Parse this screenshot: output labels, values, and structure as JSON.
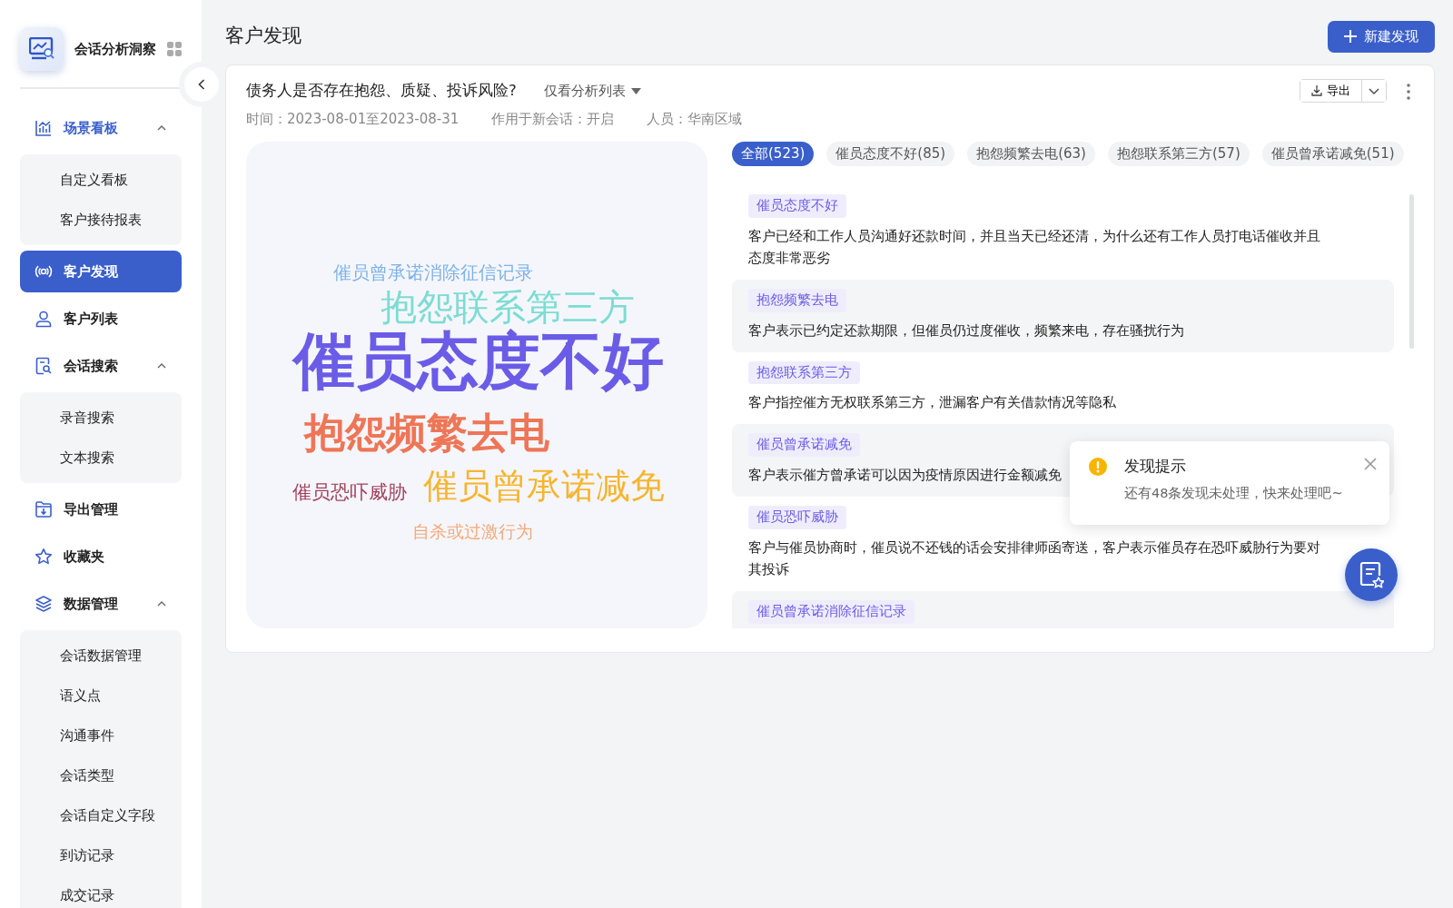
{
  "sidebar": {
    "app_title": "会话分析洞察",
    "items": [
      {
        "label": "场景看板",
        "selected": false,
        "active": true,
        "expanded": true,
        "children": [
          {
            "label": "自定义看板",
            "selected": false
          },
          {
            "label": "客户接待报表",
            "selected": false
          }
        ]
      },
      {
        "label": "客户发现",
        "selected": true,
        "active": false
      },
      {
        "label": "客户列表",
        "selected": false,
        "active": false
      },
      {
        "label": "会话搜索",
        "selected": false,
        "active": false,
        "expanded": true,
        "children": [
          {
            "label": "录音搜索",
            "selected": false
          },
          {
            "label": "文本搜索",
            "selected": false
          }
        ]
      },
      {
        "label": "导出管理",
        "selected": false,
        "active": false
      },
      {
        "label": "收藏夹",
        "selected": false,
        "active": false
      },
      {
        "label": "数据管理",
        "selected": false,
        "active": false,
        "expanded": true,
        "children": [
          {
            "label": "会话数据管理",
            "selected": false
          },
          {
            "label": "语义点",
            "selected": false
          },
          {
            "label": "沟通事件",
            "selected": false
          },
          {
            "label": "会话类型",
            "selected": false
          },
          {
            "label": "会话自定义字段",
            "selected": false
          },
          {
            "label": "到访记录",
            "selected": false
          },
          {
            "label": "成交记录",
            "selected": false
          }
        ]
      }
    ]
  },
  "header": {
    "title": "客户发现",
    "new_button": "新建发现"
  },
  "discovery": {
    "question": "债务人是否存在抱怨、质疑、投诉风险?",
    "view_filter": "仅看分析列表",
    "export_button": "导出",
    "meta": [
      "时间：2023-08-01至2023-08-31",
      "作用于新会话：开启",
      "人员：华南区域"
    ]
  },
  "word_cloud": [
    {
      "text": "催员曾承诺消除征信记录",
      "color": "#7bb3ea"
    },
    {
      "text": "抱怨联系第三方",
      "color": "#7ddcd3"
    },
    {
      "text": "催员态度不好",
      "color": "#6b5ce7"
    },
    {
      "text": "抱怨频繁去电",
      "color": "#ee7656"
    },
    {
      "text": "催员恐吓威胁",
      "color": "#a0425a"
    },
    {
      "text": "催员曾承诺减免",
      "color": "#f6b530"
    },
    {
      "text": "自杀或过激行为",
      "color": "#f5a97a"
    }
  ],
  "filter_chips": [
    {
      "label": "全部(523)",
      "selected": true
    },
    {
      "label": "催员态度不好(85)",
      "selected": false
    },
    {
      "label": "抱怨频繁去电(63)",
      "selected": false
    },
    {
      "label": "抱怨联系第三方(57)",
      "selected": false
    },
    {
      "label": "催员曾承诺减免(51)",
      "selected": false
    }
  ],
  "findings": [
    {
      "tag": "催员态度不好",
      "text": "客户已经和工作人员沟通好还款时间，并且当天已经还清，为什么还有工作人员打电话催收并且态度非常恶劣"
    },
    {
      "tag": "抱怨频繁去电",
      "text": "客户表示已约定还款期限，但催员仍过度催收，频繁来电，存在骚扰行为"
    },
    {
      "tag": "抱怨联系第三方",
      "text": "客户指控催方无权联系第三方，泄漏客户有关借款情况等隐私"
    },
    {
      "tag": "催员曾承诺减免",
      "text": "客户表示催方曾承诺可以因为疫情原因进行金额减免"
    },
    {
      "tag": "催员恐吓威胁",
      "text": "客户与催员协商时，催员说不还钱的话会安排律师函寄送，客户表示催员存在恐吓威胁行为要对其投诉"
    },
    {
      "tag": "催员曾承诺消除征信记录"
    }
  ],
  "toast": {
    "title": "发现提示",
    "message": "还有48条发现未处理，快来处理吧~"
  }
}
